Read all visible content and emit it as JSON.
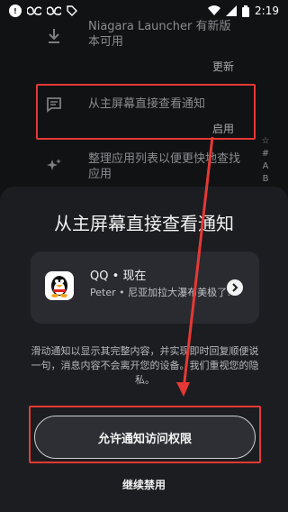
{
  "status_bar": {
    "left_icons": [
      "notification-badge-icon",
      "loop-icon",
      "loop-icon",
      "tag-icon"
    ],
    "right_icons": [
      "wifi-icon",
      "signal-icon",
      "battery-icon"
    ],
    "time": "2:19"
  },
  "background": {
    "row1": {
      "text": "Niagara Launcher 有新版本可用",
      "action": "更新"
    },
    "row2": {
      "text": "从主屏幕直接查看通知",
      "action": "启用"
    },
    "row3": {
      "text": "整理应用列表以便更快地查找应用"
    },
    "alpha_letters": [
      "☆",
      "#",
      "A",
      "B"
    ]
  },
  "sheet": {
    "title": "从主屏幕直接查看通知",
    "notification": {
      "app": "QQ • 现在",
      "body": "Peter • 尼亚加拉大瀑布美极了!"
    },
    "description": "滑动通知以显示其完整内容，并实现即时回复顺便说一句，消息内容不会离开您的设备。我们重视您的隐私。",
    "allow_button": "允许通知访问权限",
    "keep_disabled_button": "继续禁用"
  },
  "colors": {
    "highlight": "#e53935",
    "sheet_bg": "#1c1d21"
  }
}
